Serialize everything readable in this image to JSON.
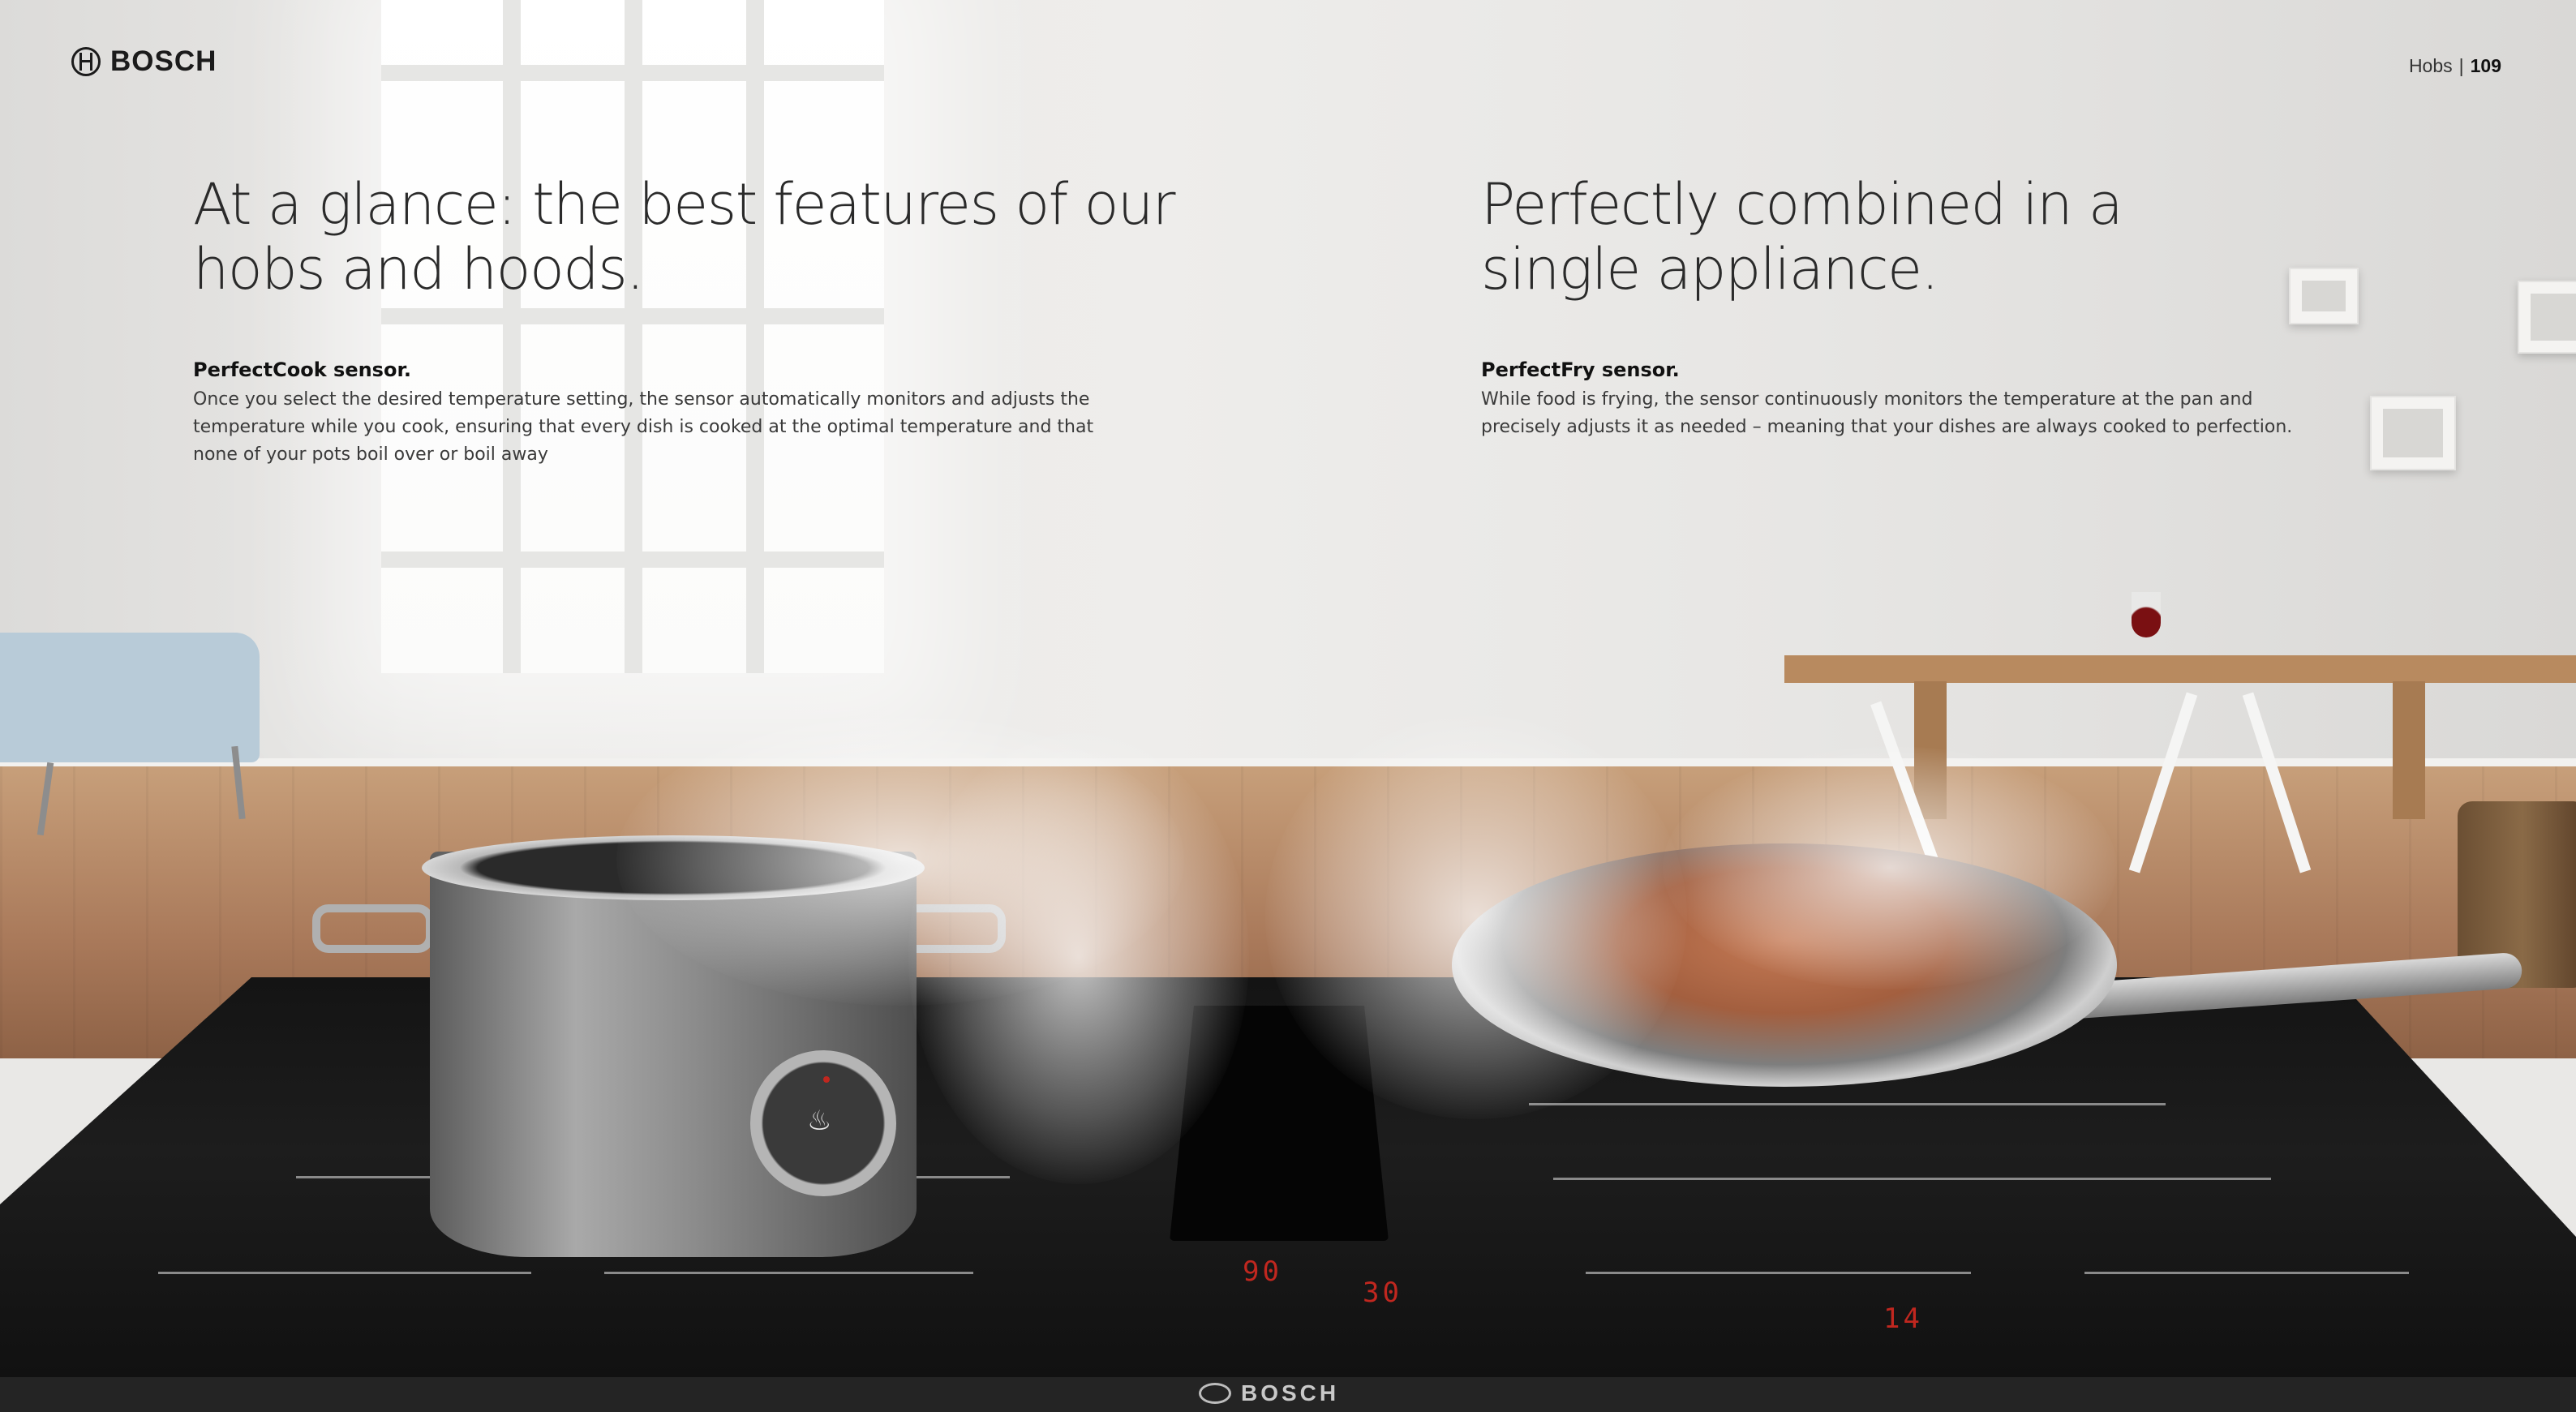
{
  "header": {
    "brand": "BOSCH",
    "section": "Hobs",
    "separator": "|",
    "page_number": "109"
  },
  "left": {
    "heading_line1": "At a glance: the best features of our",
    "heading_line2": "hobs and hoods.",
    "feature_title": "PerfectCook sensor.",
    "feature_body_line1": "Once you select the desired temperature setting, the sensor automatically monitors and adjusts the",
    "feature_body_line2": "temperature while you cook, ensuring that every dish is cooked at the optimal temperature and that",
    "feature_body_line3": "none of your pots boil over or boil away"
  },
  "right": {
    "heading_line1": "Perfectly combined in a",
    "heading_line2": "single appliance.",
    "feature_title": "PerfectFry sensor.",
    "feature_body_line1": "While food is frying, the sensor continuously monitors the temperature at the pan and",
    "feature_body_line2": "precisely adjusts it as needed – meaning that your dishes are always cooked to perfection."
  },
  "appliance": {
    "brand_on_hob": "BOSCH",
    "display_readout_1": "90",
    "display_readout_2": "30",
    "display_readout_3": "14"
  },
  "colors": {
    "text_dark": "#2a2a2a",
    "hob_black": "#141414",
    "led_red": "#c0271f"
  }
}
